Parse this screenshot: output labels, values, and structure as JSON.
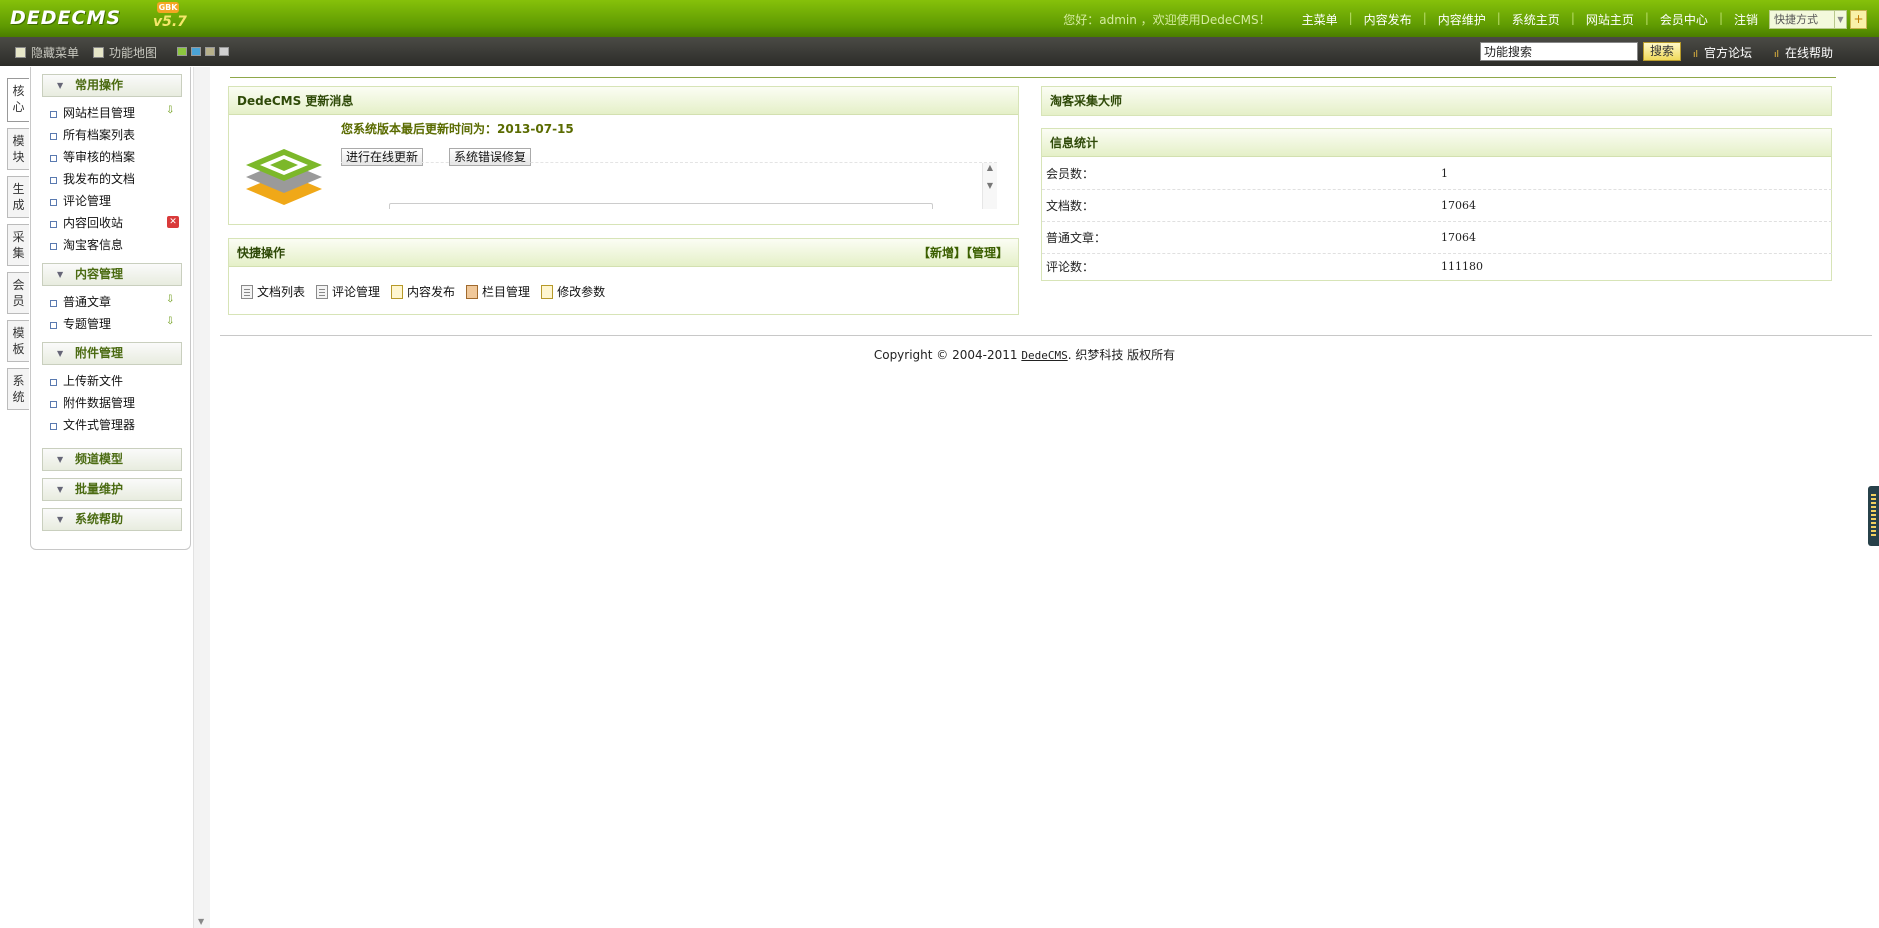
{
  "header": {
    "logo_text": "DEDECMS",
    "logo_version": "v5.7",
    "logo_badge": "GBK",
    "greeting": "您好：admin ，欢迎使用DedeCMS！",
    "nav": [
      "主菜单",
      "内容发布",
      "内容维护",
      "系统主页",
      "网站主页",
      "会员中心",
      "注销"
    ],
    "quick_select": "快捷方式",
    "plus_label": "+"
  },
  "toolbar": {
    "hide_menu": "隐藏菜单",
    "site_map": "功能地图",
    "skins": [
      "#8cc63f",
      "#4aa3d6",
      "#b7b08a",
      "#d0d0d0"
    ],
    "search_value": "功能搜索",
    "search_button": "搜索",
    "forum": "官方论坛",
    "help": "在线帮助"
  },
  "side_tabs": [
    [
      "核",
      "心"
    ],
    [
      "模",
      "块"
    ],
    [
      "生",
      "成"
    ],
    [
      "采",
      "集"
    ],
    [
      "会",
      "员"
    ],
    [
      "模",
      "板"
    ],
    [
      "系",
      "统"
    ]
  ],
  "menu": {
    "groups": [
      {
        "title": "常用操作",
        "items": [
          {
            "label": "网站栏目管理",
            "badge": "add"
          },
          {
            "label": "所有档案列表",
            "badge": ""
          },
          {
            "label": "等审核的档案",
            "badge": ""
          },
          {
            "label": "我发布的文档",
            "badge": ""
          },
          {
            "label": "评论管理",
            "badge": ""
          },
          {
            "label": "内容回收站",
            "badge": "del"
          },
          {
            "label": "淘宝客信息",
            "badge": ""
          }
        ]
      },
      {
        "title": "内容管理",
        "items": [
          {
            "label": "普通文章",
            "badge": "add"
          },
          {
            "label": "专题管理",
            "badge": "add"
          }
        ]
      },
      {
        "title": "附件管理",
        "items": [
          {
            "label": "上传新文件",
            "badge": ""
          },
          {
            "label": "附件数据管理",
            "badge": ""
          },
          {
            "label": "文件式管理器",
            "badge": ""
          }
        ]
      },
      {
        "title": "频道模型",
        "items": []
      },
      {
        "title": "批量维护",
        "items": []
      },
      {
        "title": "系统帮助",
        "items": []
      }
    ]
  },
  "update_box": {
    "title": "DedeCMS 更新消息",
    "last_update": "您系统版本最后更新时间为：2013-07-15",
    "online_update": "进行在线更新",
    "error_fix": "系统错误修复"
  },
  "quick_ops": {
    "title": "快捷操作",
    "extra": "【新增】【管理】",
    "items": [
      {
        "label": "文档列表",
        "icon": "doc"
      },
      {
        "label": "评论管理",
        "icon": "doc"
      },
      {
        "label": "内容发布",
        "icon": "edit"
      },
      {
        "label": "栏目管理",
        "icon": "cat"
      },
      {
        "label": "修改参数",
        "icon": "edit"
      }
    ]
  },
  "taoke_box": {
    "title": "淘客采集大师"
  },
  "stats_box": {
    "title": "信息统计",
    "rows": [
      {
        "key": "会员数：",
        "value": "1"
      },
      {
        "key": "文档数：",
        "value": "17064"
      },
      {
        "key": "普通文章：",
        "value": "17064"
      },
      {
        "key": "评论数：",
        "value": "111180"
      }
    ]
  },
  "footer": {
    "copyright_pre": "Copyright © 2004-2011 ",
    "copyright_link": "DedeCMS",
    "copyright_post": ". 织梦科技 版权所有"
  }
}
